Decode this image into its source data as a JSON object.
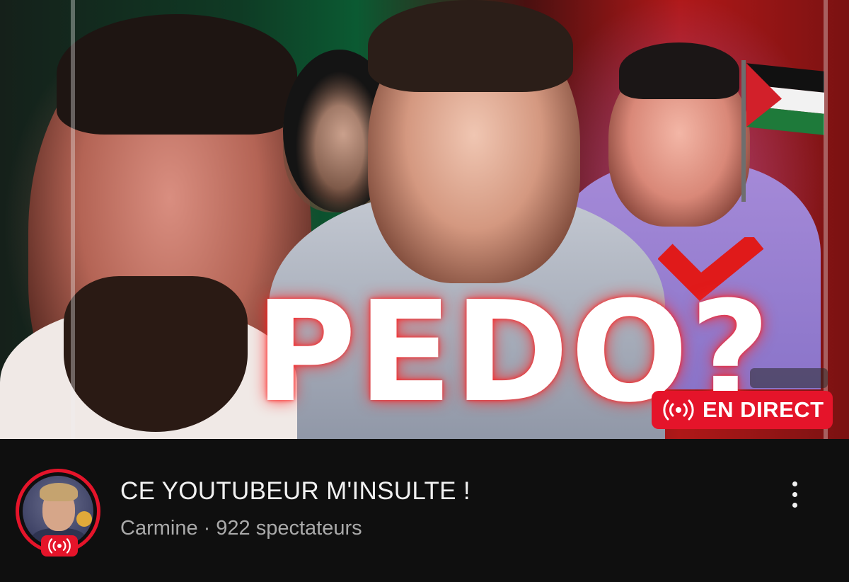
{
  "video": {
    "thumbnail_text": "PEDO",
    "thumbnail_mark": "?",
    "live_badge_label": "EN DIRECT",
    "title": "CE YOUTUBEUR M'INSULTE !",
    "channel_name": "Carmine",
    "separator": "·",
    "viewers": "922 spectateurs"
  },
  "icons": {
    "live": "broadcast-icon",
    "avatar_live": "broadcast-icon",
    "more": "more-vertical-icon"
  },
  "colors": {
    "live_red": "#e5142a",
    "background": "#0f0f0f",
    "title_text": "#f1f1f1",
    "sub_text": "#aaaaaa"
  }
}
